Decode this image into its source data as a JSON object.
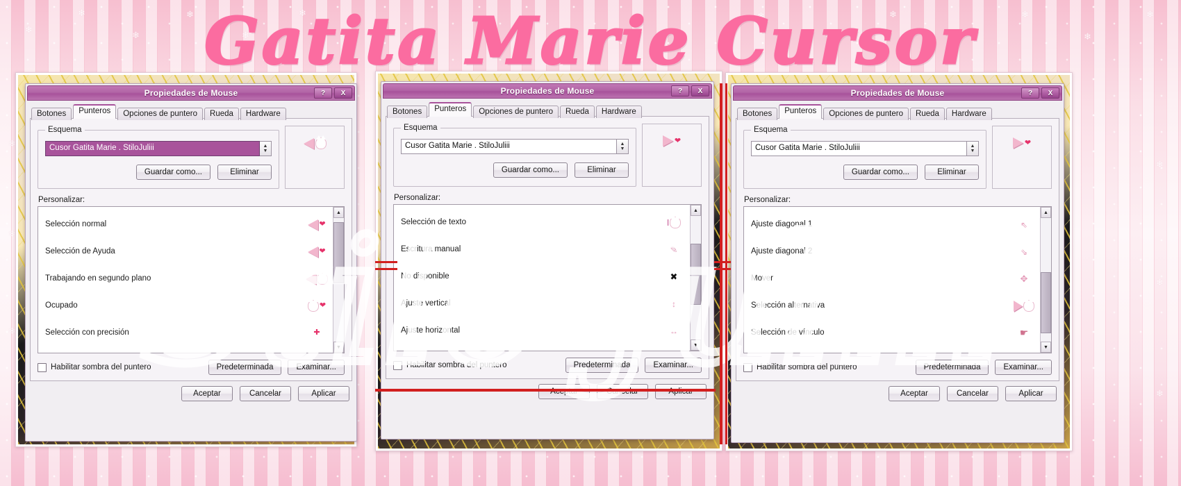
{
  "banner": {
    "title": "Gatita Marie Cursor"
  },
  "watermark": {
    "text": "Stilo Juliii"
  },
  "dialog_common": {
    "window_title": "Propiedades de Mouse",
    "help_button": "?",
    "close_button": "X",
    "tabs": [
      {
        "label": "Botones",
        "active": false
      },
      {
        "label": "Punteros",
        "active": true
      },
      {
        "label": "Opciones de puntero",
        "active": false
      },
      {
        "label": "Rueda",
        "active": false
      },
      {
        "label": "Hardware",
        "active": false
      }
    ],
    "scheme_group_label": "Esquema",
    "scheme_value": "Cusor Gatita Marie . StiloJuliii",
    "save_as_label": "Guardar como...",
    "delete_label": "Eliminar",
    "customize_label": "Personalizar:",
    "shadow_checkbox_label": "Habilitar sombra del puntero",
    "default_button": "Predeterminada",
    "browse_button": "Examinar...",
    "ok_button": "Aceptar",
    "cancel_button": "Cancelar",
    "apply_button": "Aplicar",
    "spin_up": "▲",
    "spin_down": "▼"
  },
  "dialogs": [
    {
      "id": "dialog-1",
      "scheme_selected": true,
      "items": [
        "Selección normal",
        "Selección de Ayuda",
        "Trabajando en segundo plano",
        "Ocupado",
        "Selección con precisión"
      ]
    },
    {
      "id": "dialog-2",
      "scheme_selected": false,
      "items": [
        "Selección de texto",
        "Escritura manual",
        "No disponible",
        "Ajuste vertical",
        "Ajuste horizontal"
      ]
    },
    {
      "id": "dialog-3",
      "scheme_selected": false,
      "items": [
        "Ajuste diagonal 1",
        "Ajuste diagonal 2",
        "Mover",
        "Selección alternativa",
        "Selección de vínculo"
      ]
    }
  ],
  "colors": {
    "accent_pink": "#fb6ca0",
    "titlebar_purple": "#a8539b",
    "annotation_red": "#d21f1f",
    "background_pink": "#f7bfd0"
  }
}
